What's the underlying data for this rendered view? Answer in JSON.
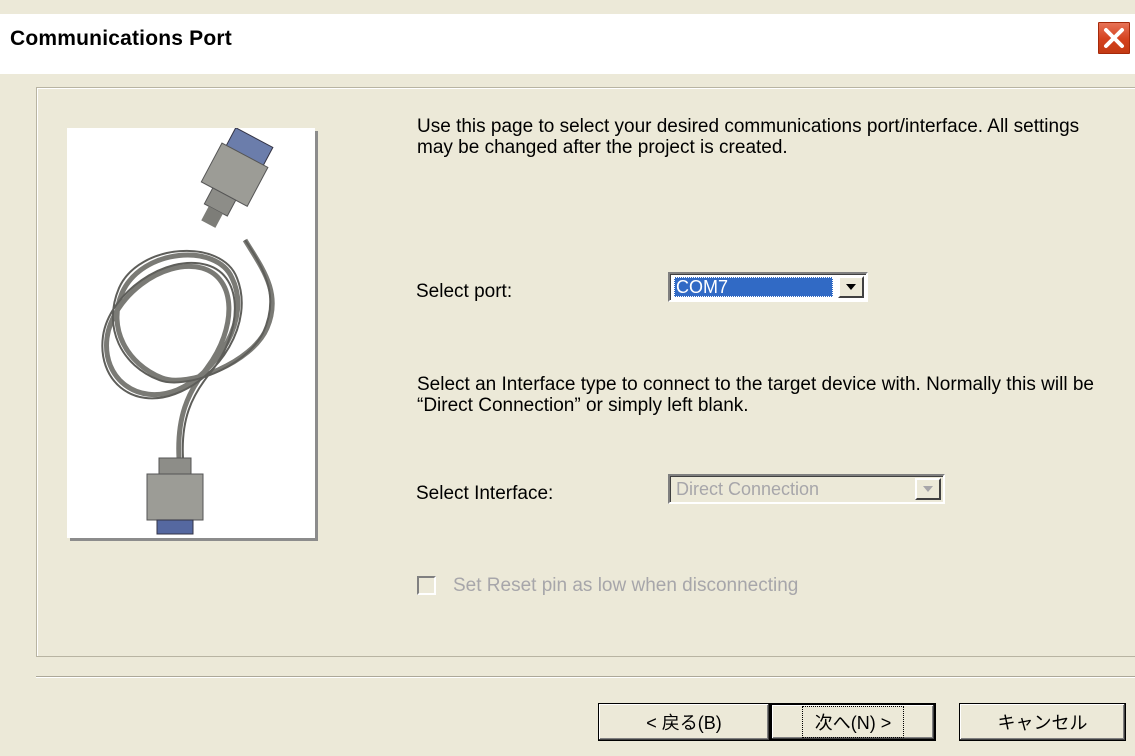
{
  "window": {
    "title": "Communications Port",
    "close_icon": "close-icon"
  },
  "description": "Use this page to select your desired communications port/interface. All settings may be changed after the project is created.",
  "port": {
    "label": "Select port:",
    "value": "COM7"
  },
  "interface_description": "Select an Interface type to connect to the target device with. Normally this will be “Direct Connection” or simply left blank.",
  "interface": {
    "label": "Select Interface:",
    "value": "Direct Connection",
    "disabled": true
  },
  "reset_option": {
    "label": "Set Reset pin as low when disconnecting",
    "checked": false,
    "disabled": true
  },
  "buttons": {
    "back": "< 戻る(B)",
    "next": "次へ(N) >",
    "cancel": "キャンセル"
  },
  "colors": {
    "dialog_bg": "#ece9d8",
    "selection": "#316ac5",
    "close_button": "#d4411d",
    "disabled_text": "#a7a6aa"
  },
  "image": {
    "icon": "serial-cable-image"
  }
}
